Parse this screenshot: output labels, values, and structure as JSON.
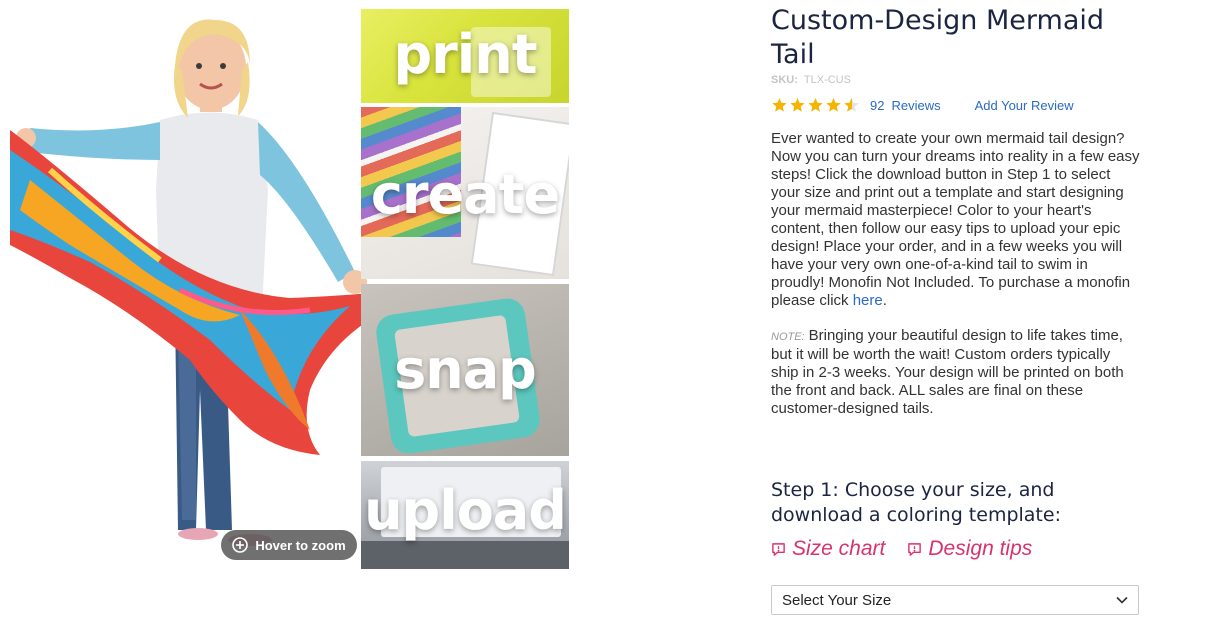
{
  "gallery": {
    "zoom_hint": "Hover to zoom",
    "tiles": [
      "print",
      "create",
      "snap",
      "upload"
    ]
  },
  "product": {
    "title": "Custom-Design Mermaid Tail",
    "sku_label": "SKU:",
    "sku_value": "TLX-CUS",
    "rating": 4.5,
    "review_count": "92",
    "reviews_label": "Reviews",
    "add_review": "Add Your Review",
    "description": "Ever wanted to create your own mermaid tail design? Now you can turn your dreams into reality in a few easy steps! Click the download button in Step 1 to select your size and print out a template and start designing your mermaid masterpiece! Color to your heart's content, then follow our easy tips to upload your epic design! Place your order, and in a few weeks you will have your very own one-of-a-kind tail to swim in proudly! Monofin Not Included. To purchase a monofin please click ",
    "description_link": "here",
    "description_end": ".",
    "note_label": "NOTE:",
    "note_text": "Bringing your beautiful design to life takes time, but it will be worth the wait! Custom orders typically ship in 2-3 weeks. Your design will be printed on both the front and back. ALL sales are final on these customer-designed tails."
  },
  "step1": {
    "heading": "Step 1: Choose your size, and download a coloring template:",
    "size_chart": "Size chart",
    "design_tips": "Design tips",
    "select_placeholder": "Select Your Size"
  },
  "colors": {
    "title": "#1b2540",
    "link": "#2a6ac2",
    "accent_pink": "#d9336c",
    "star": "#f5b400"
  },
  "icons": [
    "zoom-plus-icon",
    "star-icon",
    "comment-icon",
    "chevron-down-icon"
  ]
}
